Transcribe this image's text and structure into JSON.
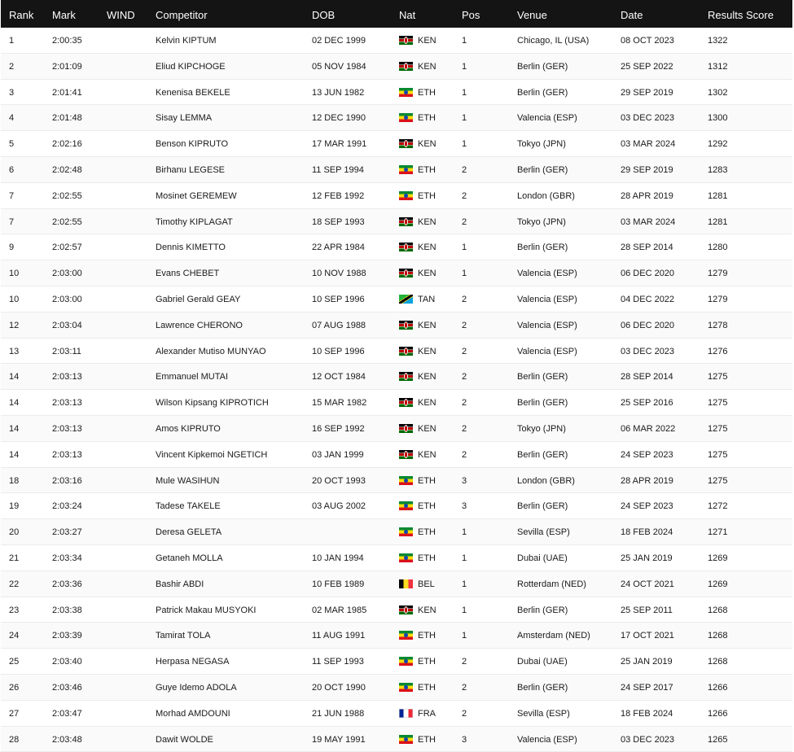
{
  "headers": {
    "rank": "Rank",
    "mark": "Mark",
    "wind": "WIND",
    "competitor": "Competitor",
    "dob": "DOB",
    "nat": "Nat",
    "pos": "Pos",
    "venue": "Venue",
    "date": "Date",
    "score": "Results Score"
  },
  "colors": {
    "header_bg": "#141414",
    "header_text": "#ffffff",
    "row_text": "#1a1a1a"
  },
  "rows": [
    {
      "rank": "1",
      "mark": "2:00:35",
      "wind": "",
      "competitor": "Kelvin KIPTUM",
      "dob": "02 DEC 1999",
      "nat": "KEN",
      "pos": "1",
      "venue": "Chicago, IL (USA)",
      "date": "08 OCT 2023",
      "score": "1322"
    },
    {
      "rank": "2",
      "mark": "2:01:09",
      "wind": "",
      "competitor": "Eliud KIPCHOGE",
      "dob": "05 NOV 1984",
      "nat": "KEN",
      "pos": "1",
      "venue": "Berlin (GER)",
      "date": "25 SEP 2022",
      "score": "1312"
    },
    {
      "rank": "3",
      "mark": "2:01:41",
      "wind": "",
      "competitor": "Kenenisa BEKELE",
      "dob": "13 JUN 1982",
      "nat": "ETH",
      "pos": "1",
      "venue": "Berlin (GER)",
      "date": "29 SEP 2019",
      "score": "1302"
    },
    {
      "rank": "4",
      "mark": "2:01:48",
      "wind": "",
      "competitor": "Sisay LEMMA",
      "dob": "12 DEC 1990",
      "nat": "ETH",
      "pos": "1",
      "venue": "Valencia (ESP)",
      "date": "03 DEC 2023",
      "score": "1300"
    },
    {
      "rank": "5",
      "mark": "2:02:16",
      "wind": "",
      "competitor": "Benson KIPRUTO",
      "dob": "17 MAR 1991",
      "nat": "KEN",
      "pos": "1",
      "venue": "Tokyo (JPN)",
      "date": "03 MAR 2024",
      "score": "1292"
    },
    {
      "rank": "6",
      "mark": "2:02:48",
      "wind": "",
      "competitor": "Birhanu LEGESE",
      "dob": "11 SEP 1994",
      "nat": "ETH",
      "pos": "2",
      "venue": "Berlin (GER)",
      "date": "29 SEP 2019",
      "score": "1283"
    },
    {
      "rank": "7",
      "mark": "2:02:55",
      "wind": "",
      "competitor": "Mosinet GEREMEW",
      "dob": "12 FEB 1992",
      "nat": "ETH",
      "pos": "2",
      "venue": "London (GBR)",
      "date": "28 APR 2019",
      "score": "1281"
    },
    {
      "rank": "7",
      "mark": "2:02:55",
      "wind": "",
      "competitor": "Timothy KIPLAGAT",
      "dob": "18 SEP 1993",
      "nat": "KEN",
      "pos": "2",
      "venue": "Tokyo (JPN)",
      "date": "03 MAR 2024",
      "score": "1281"
    },
    {
      "rank": "9",
      "mark": "2:02:57",
      "wind": "",
      "competitor": "Dennis KIMETTO",
      "dob": "22 APR 1984",
      "nat": "KEN",
      "pos": "1",
      "venue": "Berlin (GER)",
      "date": "28 SEP 2014",
      "score": "1280"
    },
    {
      "rank": "10",
      "mark": "2:03:00",
      "wind": "",
      "competitor": "Evans CHEBET",
      "dob": "10 NOV 1988",
      "nat": "KEN",
      "pos": "1",
      "venue": "Valencia (ESP)",
      "date": "06 DEC 2020",
      "score": "1279"
    },
    {
      "rank": "10",
      "mark": "2:03:00",
      "wind": "",
      "competitor": "Gabriel Gerald GEAY",
      "dob": "10 SEP 1996",
      "nat": "TAN",
      "pos": "2",
      "venue": "Valencia (ESP)",
      "date": "04 DEC 2022",
      "score": "1279"
    },
    {
      "rank": "12",
      "mark": "2:03:04",
      "wind": "",
      "competitor": "Lawrence CHERONO",
      "dob": "07 AUG 1988",
      "nat": "KEN",
      "pos": "2",
      "venue": "Valencia (ESP)",
      "date": "06 DEC 2020",
      "score": "1278"
    },
    {
      "rank": "13",
      "mark": "2:03:11",
      "wind": "",
      "competitor": "Alexander Mutiso MUNYAO",
      "dob": "10 SEP 1996",
      "nat": "KEN",
      "pos": "2",
      "venue": "Valencia (ESP)",
      "date": "03 DEC 2023",
      "score": "1276"
    },
    {
      "rank": "14",
      "mark": "2:03:13",
      "wind": "",
      "competitor": "Emmanuel MUTAI",
      "dob": "12 OCT 1984",
      "nat": "KEN",
      "pos": "2",
      "venue": "Berlin (GER)",
      "date": "28 SEP 2014",
      "score": "1275"
    },
    {
      "rank": "14",
      "mark": "2:03:13",
      "wind": "",
      "competitor": "Wilson Kipsang KIPROTICH",
      "dob": "15 MAR 1982",
      "nat": "KEN",
      "pos": "2",
      "venue": "Berlin (GER)",
      "date": "25 SEP 2016",
      "score": "1275"
    },
    {
      "rank": "14",
      "mark": "2:03:13",
      "wind": "",
      "competitor": "Amos KIPRUTO",
      "dob": "16 SEP 1992",
      "nat": "KEN",
      "pos": "2",
      "venue": "Tokyo (JPN)",
      "date": "06 MAR 2022",
      "score": "1275"
    },
    {
      "rank": "14",
      "mark": "2:03:13",
      "wind": "",
      "competitor": "Vincent Kipkemoi NGETICH",
      "dob": "03 JAN 1999",
      "nat": "KEN",
      "pos": "2",
      "venue": "Berlin (GER)",
      "date": "24 SEP 2023",
      "score": "1275"
    },
    {
      "rank": "18",
      "mark": "2:03:16",
      "wind": "",
      "competitor": "Mule WASIHUN",
      "dob": "20 OCT 1993",
      "nat": "ETH",
      "pos": "3",
      "venue": "London (GBR)",
      "date": "28 APR 2019",
      "score": "1275"
    },
    {
      "rank": "19",
      "mark": "2:03:24",
      "wind": "",
      "competitor": "Tadese TAKELE",
      "dob": "03 AUG 2002",
      "nat": "ETH",
      "pos": "3",
      "venue": "Berlin (GER)",
      "date": "24 SEP 2023",
      "score": "1272"
    },
    {
      "rank": "20",
      "mark": "2:03:27",
      "wind": "",
      "competitor": "Deresa GELETA",
      "dob": "",
      "nat": "ETH",
      "pos": "1",
      "venue": "Sevilla (ESP)",
      "date": "18 FEB 2024",
      "score": "1271"
    },
    {
      "rank": "21",
      "mark": "2:03:34",
      "wind": "",
      "competitor": "Getaneh MOLLA",
      "dob": "10 JAN 1994",
      "nat": "ETH",
      "pos": "1",
      "venue": "Dubai (UAE)",
      "date": "25 JAN 2019",
      "score": "1269"
    },
    {
      "rank": "22",
      "mark": "2:03:36",
      "wind": "",
      "competitor": "Bashir ABDI",
      "dob": "10 FEB 1989",
      "nat": "BEL",
      "pos": "1",
      "venue": "Rotterdam (NED)",
      "date": "24 OCT 2021",
      "score": "1269"
    },
    {
      "rank": "23",
      "mark": "2:03:38",
      "wind": "",
      "competitor": "Patrick Makau MUSYOKI",
      "dob": "02 MAR 1985",
      "nat": "KEN",
      "pos": "1",
      "venue": "Berlin (GER)",
      "date": "25 SEP 2011",
      "score": "1268"
    },
    {
      "rank": "24",
      "mark": "2:03:39",
      "wind": "",
      "competitor": "Tamirat TOLA",
      "dob": "11 AUG 1991",
      "nat": "ETH",
      "pos": "1",
      "venue": "Amsterdam (NED)",
      "date": "17 OCT 2021",
      "score": "1268"
    },
    {
      "rank": "25",
      "mark": "2:03:40",
      "wind": "",
      "competitor": "Herpasa NEGASA",
      "dob": "11 SEP 1993",
      "nat": "ETH",
      "pos": "2",
      "venue": "Dubai (UAE)",
      "date": "25 JAN 2019",
      "score": "1268"
    },
    {
      "rank": "26",
      "mark": "2:03:46",
      "wind": "",
      "competitor": "Guye Idemo ADOLA",
      "dob": "20 OCT 1990",
      "nat": "ETH",
      "pos": "2",
      "venue": "Berlin (GER)",
      "date": "24 SEP 2017",
      "score": "1266"
    },
    {
      "rank": "27",
      "mark": "2:03:47",
      "wind": "",
      "competitor": "Morhad AMDOUNI",
      "dob": "21 JUN 1988",
      "nat": "FRA",
      "pos": "2",
      "venue": "Sevilla (ESP)",
      "date": "18 FEB 2024",
      "score": "1266"
    },
    {
      "rank": "28",
      "mark": "2:03:48",
      "wind": "",
      "competitor": "Dawit WOLDE",
      "dob": "19 MAY 1991",
      "nat": "ETH",
      "pos": "3",
      "venue": "Valencia (ESP)",
      "date": "03 DEC 2023",
      "score": "1265"
    }
  ]
}
